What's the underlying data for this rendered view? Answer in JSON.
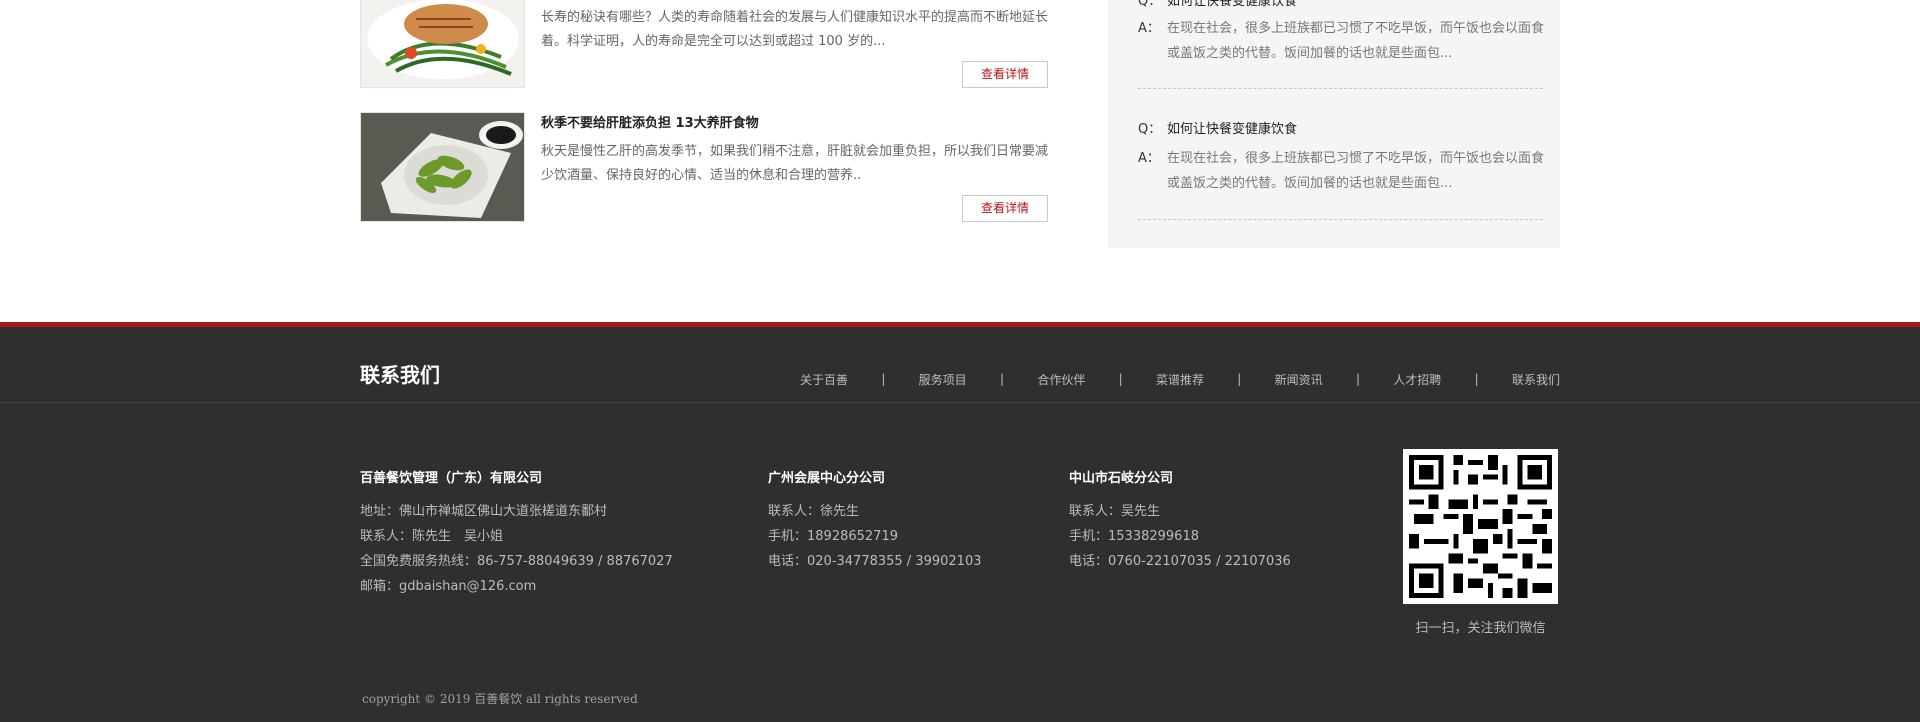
{
  "news": [
    {
      "title": "",
      "desc": " 长寿的秘诀有哪些？人类的寿命随着社会的发展与人们健康知识水平的提高而不断地延长着。科学证明，人的寿命是完全可以达到或超过 100 岁的...",
      "button": "查看详情",
      "image_icon": "salmon-dish-image"
    },
    {
      "title": "秋季不要给肝脏添负担 13大养肝食物",
      "desc": "秋天是慢性乙肝的高发季节，如果我们稍不注意，肝脏就会加重负担，所以我们日常要减少饮酒量、保持良好的心情、适当的休息和合理的营养..",
      "button": "查看详情",
      "image_icon": "edamame-dish-image"
    }
  ],
  "faq": [
    {
      "q_label": "Q：",
      "question": "如何让快餐变健康饮食",
      "a_label": "A：",
      "answer": "在现在社会，很多上班族都已习惯了不吃早饭，而午饭也会以面食或盖饭之类的代替。饭间加餐的话也就是些面包..."
    },
    {
      "q_label": "Q：",
      "question": "如何让快餐变健康饮食",
      "a_label": "A：",
      "answer": "在现在社会，很多上班族都已习惯了不吃早饭，而午饭也会以面食或盖饭之类的代替。饭间加餐的话也就是些面包..."
    }
  ],
  "footer": {
    "title": "联系我们",
    "nav": [
      "关于百善",
      "服务项目",
      "合作伙伴",
      "菜谱推荐",
      "新闻资讯",
      "人才招聘",
      "联系我们"
    ],
    "separator": "|",
    "columns": [
      {
        "company": "百善餐饮管理（广东）有限公司",
        "lines": [
          "地址：佛山市禅城区佛山大道张槎道东鄱村",
          "联系人：陈先生　吴小姐",
          "全国免费服务热线：86-757-88049639 / 88767027",
          "邮箱：gdbaishan@126.com"
        ]
      },
      {
        "company": "广州会展中心分公司",
        "lines": [
          "联系人：徐先生",
          "手机：18928652719",
          "电话：020-34778355 / 39902103"
        ]
      },
      {
        "company": "中山市石岐分公司",
        "lines": [
          "联系人：吴先生",
          "手机：15338299618",
          "电话：0760-22107035 / 22107036"
        ]
      }
    ],
    "qr_caption": "扫一扫，关注我们微信",
    "copyright": "copyright © 2019 百善餐饮 all rights reserved"
  },
  "colors": {
    "accent": "#a9161c",
    "button_text": "#b3141c",
    "footer_bg": "#2f2f2f",
    "faq_bg": "#f5f5f5"
  }
}
